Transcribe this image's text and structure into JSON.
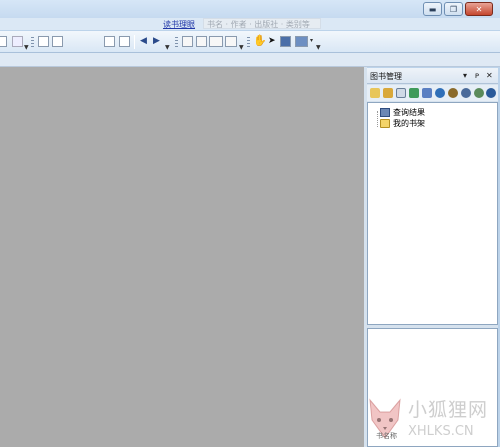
{
  "window": {
    "minimize_glyph": "▬",
    "maximize_glyph": "❐",
    "close_glyph": "✕"
  },
  "linkbar": {
    "active_link": "读书理眼",
    "search_hint": "书名 · 作者 · 出版社 · 类别等"
  },
  "panel": {
    "title": "图书管理",
    "pin_glyph": "▾",
    "dock_glyph": "ᴘ",
    "close_glyph": "✕",
    "tree": [
      {
        "label": "查询结果",
        "icon": "query-icon"
      },
      {
        "label": "我的书架",
        "icon": "folder-icon"
      }
    ]
  },
  "watermark": {
    "text": "小狐狸网",
    "url": "XHLKS.CN"
  },
  "corner_label": "书名称",
  "colors": {
    "workspace": "#ababab",
    "accent_link": "#2238a8",
    "chrome": "#d6e2ee"
  }
}
